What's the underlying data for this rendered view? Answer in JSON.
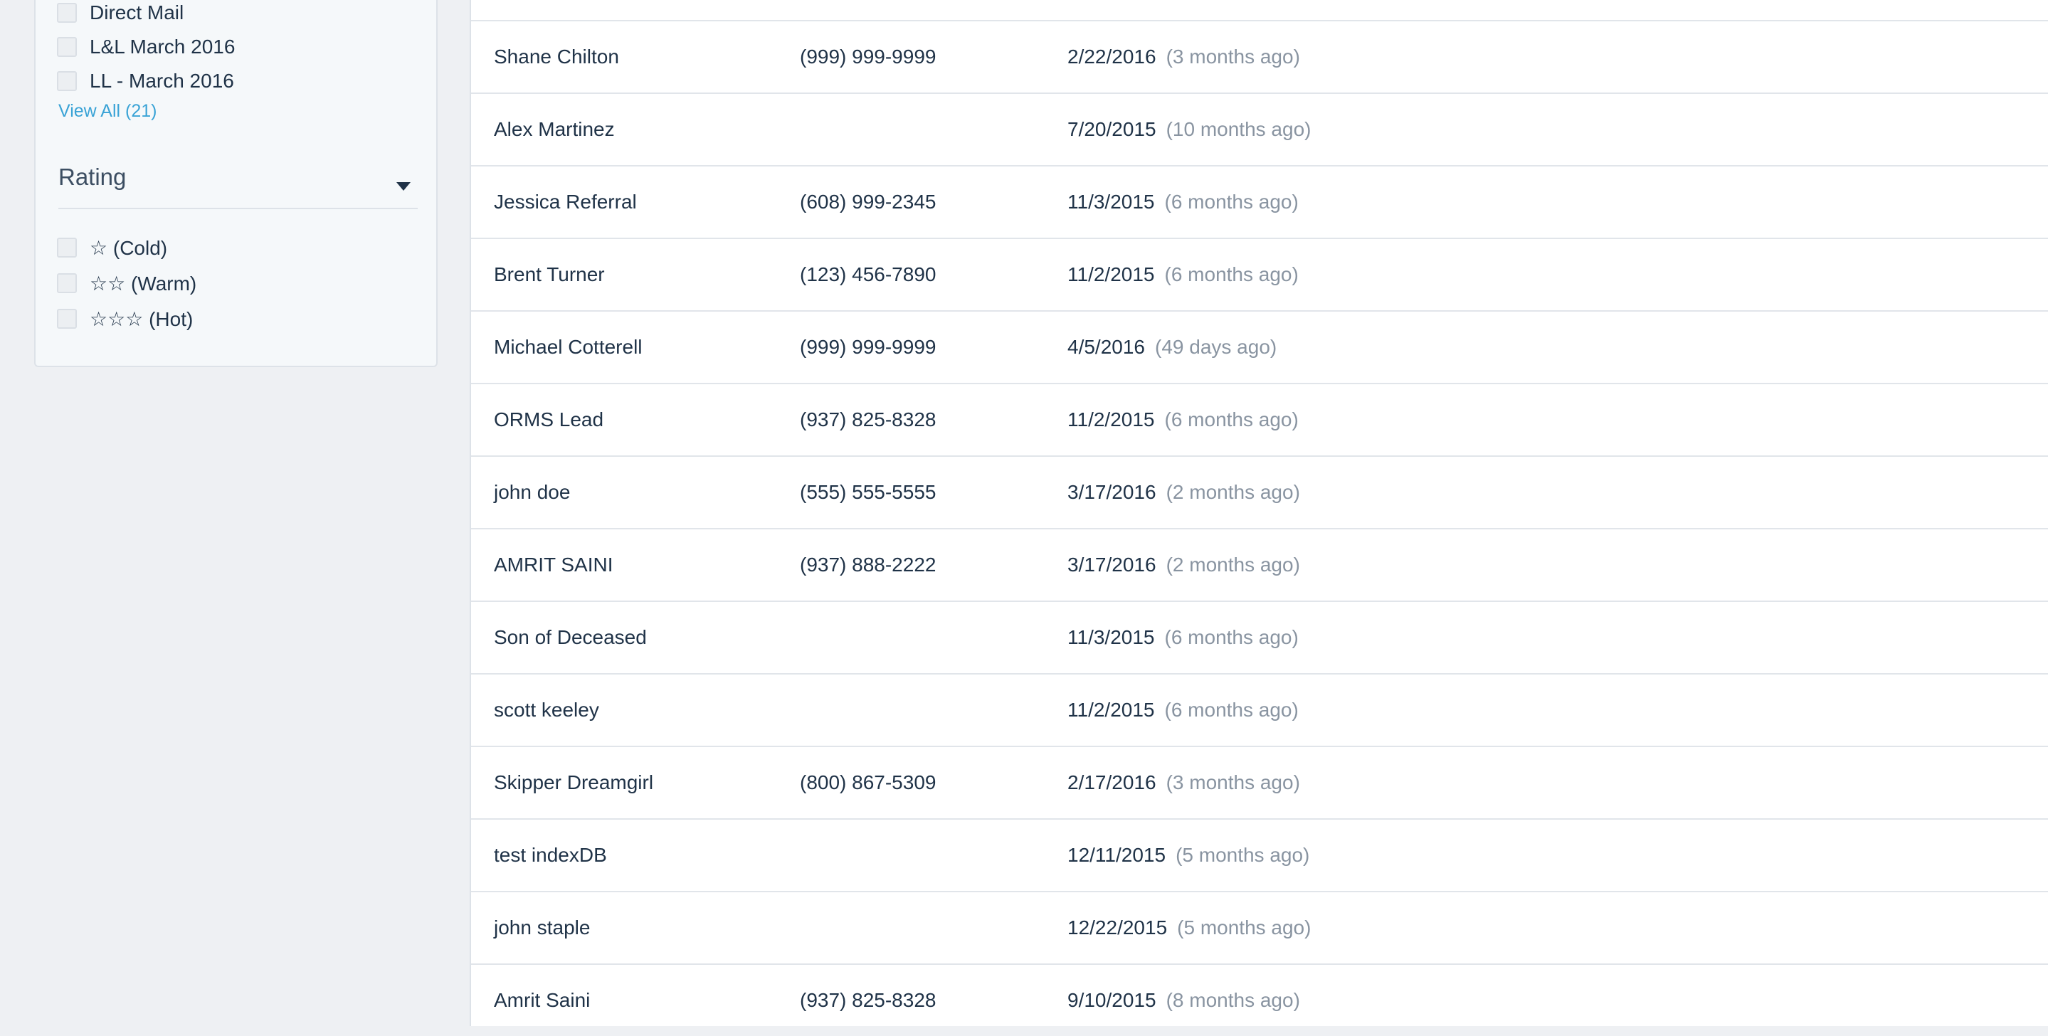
{
  "sidebar": {
    "source_items": [
      {
        "label": "Direct Mail"
      },
      {
        "label": "L&L March 2016"
      },
      {
        "label": "LL - March 2016"
      }
    ],
    "view_all_label": "View All (21)",
    "rating": {
      "title": "Rating",
      "items": [
        {
          "label": "☆ (Cold)"
        },
        {
          "label": "☆☆ (Warm)"
        },
        {
          "label": "☆☆☆ (Hot)"
        }
      ]
    }
  },
  "leads": {
    "rows": [
      {
        "name": "Shane Chilton",
        "phone": "(999) 999-9999",
        "date": "2/22/2016",
        "ago": "(3 months ago)"
      },
      {
        "name": "Alex Martinez",
        "phone": "",
        "date": "7/20/2015",
        "ago": "(10 months ago)"
      },
      {
        "name": "Jessica Referral",
        "phone": "(608) 999-2345",
        "date": "11/3/2015",
        "ago": "(6 months ago)"
      },
      {
        "name": "Brent Turner",
        "phone": "(123) 456-7890",
        "date": "11/2/2015",
        "ago": "(6 months ago)"
      },
      {
        "name": "Michael Cotterell",
        "phone": "(999) 999-9999",
        "date": "4/5/2016",
        "ago": "(49 days ago)"
      },
      {
        "name": "ORMS Lead",
        "phone": "(937) 825-8328",
        "date": "11/2/2015",
        "ago": "(6 months ago)"
      },
      {
        "name": "john doe",
        "phone": "(555) 555-5555",
        "date": "3/17/2016",
        "ago": "(2 months ago)"
      },
      {
        "name": "AMRIT SAINI",
        "phone": "(937) 888-2222",
        "date": "3/17/2016",
        "ago": "(2 months ago)"
      },
      {
        "name": "Son of Deceased",
        "phone": "",
        "date": "11/3/2015",
        "ago": "(6 months ago)"
      },
      {
        "name": "scott keeley",
        "phone": "",
        "date": "11/2/2015",
        "ago": "(6 months ago)"
      },
      {
        "name": "Skipper Dreamgirl",
        "phone": "(800) 867-5309",
        "date": "2/17/2016",
        "ago": "(3 months ago)"
      },
      {
        "name": "test indexDB",
        "phone": "",
        "date": "12/11/2015",
        "ago": "(5 months ago)"
      },
      {
        "name": "john staple",
        "phone": "",
        "date": "12/22/2015",
        "ago": "(5 months ago)"
      },
      {
        "name": "Amrit Saini",
        "phone": "(937) 825-8328",
        "date": "9/10/2015",
        "ago": "(8 months ago)"
      }
    ]
  }
}
